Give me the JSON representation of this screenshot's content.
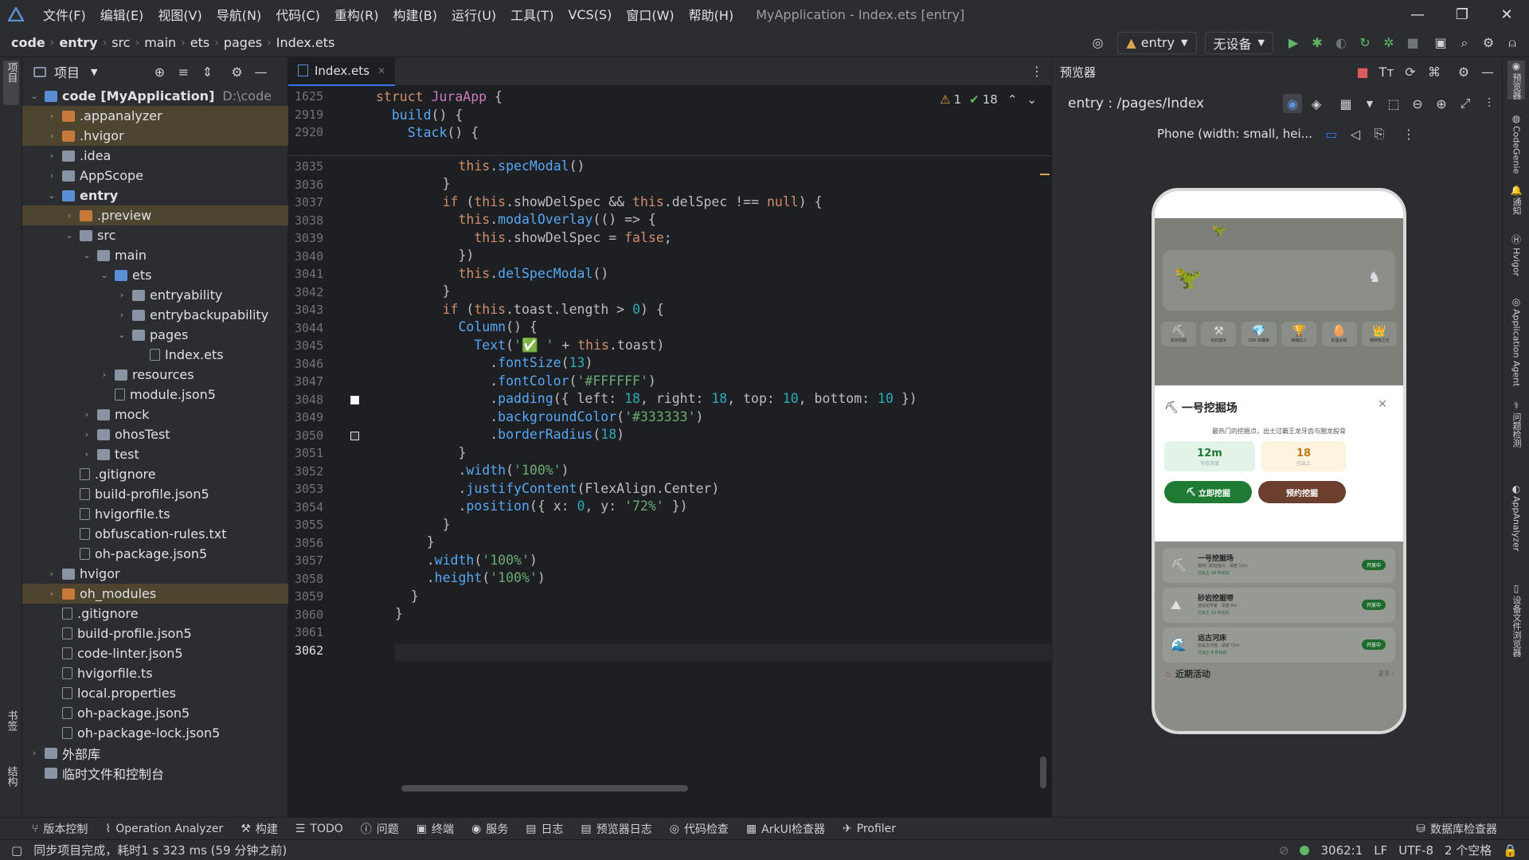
{
  "titlebar": {
    "menu": [
      "文件(F)",
      "编辑(E)",
      "视图(V)",
      "导航(N)",
      "代码(C)",
      "重构(R)",
      "构建(B)",
      "运行(U)",
      "工具(T)",
      "VCS(S)",
      "窗口(W)",
      "帮助(H)"
    ],
    "title": "MyApplication - Index.ets [entry]"
  },
  "breadcrumb": [
    "code",
    "entry",
    "src",
    "main",
    "ets",
    "pages",
    "Index.ets"
  ],
  "toolbar": {
    "module": "entry",
    "device": "无设备"
  },
  "left_strip": {
    "project": "项目",
    "bookmarks": "书签",
    "structure": "结构"
  },
  "project_panel": {
    "title": "项目",
    "tree": [
      {
        "depth": 0,
        "arrow": "down",
        "icon": "dirb",
        "label": "code [MyApplication]",
        "extra": "D:\\code",
        "bold": true
      },
      {
        "depth": 1,
        "arrow": "right",
        "icon": "dirx",
        "label": ".appanalyzer",
        "hl": true
      },
      {
        "depth": 1,
        "arrow": "right",
        "icon": "dirx",
        "label": ".hvigor",
        "hl": true
      },
      {
        "depth": 1,
        "arrow": "right",
        "icon": "dir",
        "label": ".idea"
      },
      {
        "depth": 1,
        "arrow": "right",
        "icon": "dir",
        "label": "AppScope"
      },
      {
        "depth": 1,
        "arrow": "down",
        "icon": "dirb",
        "label": "entry",
        "bold": true
      },
      {
        "depth": 2,
        "arrow": "right",
        "icon": "dirx",
        "label": ".preview",
        "hl": true
      },
      {
        "depth": 2,
        "arrow": "down",
        "icon": "dir",
        "label": "src"
      },
      {
        "depth": 3,
        "arrow": "down",
        "icon": "dir",
        "label": "main"
      },
      {
        "depth": 4,
        "arrow": "down",
        "icon": "dirb",
        "label": "ets"
      },
      {
        "depth": 5,
        "arrow": "right",
        "icon": "dir",
        "label": "entryability"
      },
      {
        "depth": 5,
        "arrow": "right",
        "icon": "dir",
        "label": "entrybackupability"
      },
      {
        "depth": 5,
        "arrow": "down",
        "icon": "dir",
        "label": "pages"
      },
      {
        "depth": 6,
        "arrow": "",
        "icon": "file",
        "label": "Index.ets"
      },
      {
        "depth": 4,
        "arrow": "right",
        "icon": "dir",
        "label": "resources"
      },
      {
        "depth": 4,
        "arrow": "",
        "icon": "file",
        "label": "module.json5"
      },
      {
        "depth": 3,
        "arrow": "right",
        "icon": "dir",
        "label": "mock"
      },
      {
        "depth": 3,
        "arrow": "right",
        "icon": "dir",
        "label": "ohosTest"
      },
      {
        "depth": 3,
        "arrow": "right",
        "icon": "dir",
        "label": "test"
      },
      {
        "depth": 2,
        "arrow": "",
        "icon": "file",
        "label": ".gitignore"
      },
      {
        "depth": 2,
        "arrow": "",
        "icon": "file",
        "label": "build-profile.json5"
      },
      {
        "depth": 2,
        "arrow": "",
        "icon": "file",
        "label": "hvigorfile.ts"
      },
      {
        "depth": 2,
        "arrow": "",
        "icon": "file",
        "label": "obfuscation-rules.txt"
      },
      {
        "depth": 2,
        "arrow": "",
        "icon": "file",
        "label": "oh-package.json5"
      },
      {
        "depth": 1,
        "arrow": "right",
        "icon": "dir",
        "label": "hvigor"
      },
      {
        "depth": 1,
        "arrow": "right",
        "icon": "dirx",
        "label": "oh_modules",
        "hl": true
      },
      {
        "depth": 1,
        "arrow": "",
        "icon": "file",
        "label": ".gitignore"
      },
      {
        "depth": 1,
        "arrow": "",
        "icon": "file",
        "label": "build-profile.json5"
      },
      {
        "depth": 1,
        "arrow": "",
        "icon": "file",
        "label": "code-linter.json5"
      },
      {
        "depth": 1,
        "arrow": "",
        "icon": "file",
        "label": "hvigorfile.ts"
      },
      {
        "depth": 1,
        "arrow": "",
        "icon": "file",
        "label": "local.properties"
      },
      {
        "depth": 1,
        "arrow": "",
        "icon": "file",
        "label": "oh-package.json5"
      },
      {
        "depth": 1,
        "arrow": "",
        "icon": "file",
        "label": "oh-package-lock.json5"
      },
      {
        "depth": 0,
        "arrow": "right",
        "icon": "dir",
        "label": "外部库"
      },
      {
        "depth": 0,
        "arrow": "",
        "icon": "dir",
        "label": "临时文件和控制台"
      }
    ]
  },
  "editor": {
    "tab": "Index.ets",
    "inspections": {
      "warnings": "1",
      "weak": "18"
    },
    "sticky": [
      {
        "n": "1625",
        "segs": [
          [
            "kw",
            "struct "
          ],
          [
            "ty",
            "JuraApp"
          ],
          [
            "pl",
            " {"
          ]
        ]
      },
      {
        "n": "2919",
        "segs": [
          [
            "pl",
            "  "
          ],
          [
            "fn",
            "build"
          ],
          [
            "pl",
            "() {"
          ]
        ]
      },
      {
        "n": "2920",
        "segs": [
          [
            "pl",
            "    "
          ],
          [
            "fn",
            "Stack"
          ],
          [
            "pl",
            "() {"
          ]
        ]
      }
    ],
    "lines": [
      {
        "n": "3035",
        "segs": [
          [
            "pl",
            "        })"
          ]
        ]
      },
      {
        "n": "3036",
        "segs": [
          [
            "pl",
            "        "
          ],
          [
            "th",
            "this"
          ],
          [
            "pl",
            "."
          ],
          [
            "ts",
            "specModal"
          ],
          [
            "pl",
            "()"
          ]
        ]
      },
      {
        "n": "3037",
        "segs": [
          [
            "pl",
            "      }"
          ]
        ]
      },
      {
        "n": "3038",
        "segs": [
          [
            "pl",
            "      "
          ],
          [
            "kw",
            "if"
          ],
          [
            "pl",
            " ("
          ],
          [
            "th",
            "this"
          ],
          [
            "pl",
            ".showDelSpec && "
          ],
          [
            "th",
            "this"
          ],
          [
            "pl",
            ".delSpec !== "
          ],
          [
            "kw",
            "null"
          ],
          [
            "pl",
            ") {"
          ]
        ]
      },
      {
        "n": "3039",
        "segs": [
          [
            "pl",
            "        "
          ],
          [
            "th",
            "this"
          ],
          [
            "pl",
            "."
          ],
          [
            "ts",
            "modalOverlay"
          ],
          [
            "pl",
            "(() => {"
          ]
        ]
      },
      {
        "n": "3040",
        "segs": [
          [
            "pl",
            "          "
          ],
          [
            "th",
            "this"
          ],
          [
            "pl",
            ".showDelSpec = "
          ],
          [
            "kw",
            "false"
          ],
          [
            "pl",
            ";"
          ]
        ]
      },
      {
        "n": "3041",
        "segs": [
          [
            "pl",
            "        })"
          ]
        ]
      },
      {
        "n": "3042",
        "segs": [
          [
            "pl",
            "        "
          ],
          [
            "th",
            "this"
          ],
          [
            "pl",
            "."
          ],
          [
            "ts",
            "delSpecModal"
          ],
          [
            "pl",
            "()"
          ]
        ]
      },
      {
        "n": "3043",
        "segs": [
          [
            "pl",
            "      }"
          ]
        ]
      },
      {
        "n": "3044",
        "segs": [
          [
            "pl",
            "      "
          ],
          [
            "kw",
            "if"
          ],
          [
            "pl",
            " ("
          ],
          [
            "th",
            "this"
          ],
          [
            "pl",
            ".toast.length > "
          ],
          [
            "nu",
            "0"
          ],
          [
            "pl",
            ") {"
          ]
        ]
      },
      {
        "n": "3045",
        "segs": [
          [
            "pl",
            "        "
          ],
          [
            "fn",
            "Column"
          ],
          [
            "pl",
            "() {"
          ]
        ]
      },
      {
        "n": "3046",
        "segs": [
          [
            "pl",
            "          "
          ],
          [
            "fn",
            "Text"
          ],
          [
            "pl",
            "("
          ],
          [
            "st",
            "'✅ '"
          ],
          [
            "pl",
            " + "
          ],
          [
            "th",
            "this"
          ],
          [
            "pl",
            ".toast)"
          ]
        ]
      },
      {
        "n": "3047",
        "segs": [
          [
            "pl",
            "            ."
          ],
          [
            "fn",
            "fontSize"
          ],
          [
            "pl",
            "("
          ],
          [
            "nu",
            "13"
          ],
          [
            "pl",
            ")"
          ]
        ]
      },
      {
        "n": "3048",
        "segs": [
          [
            "pl",
            "            ."
          ],
          [
            "fn",
            "fontColor"
          ],
          [
            "pl",
            "("
          ],
          [
            "st",
            "'#FFFFFF'"
          ],
          [
            "pl",
            ")"
          ]
        ]
      },
      {
        "n": "3049",
        "segs": [
          [
            "pl",
            "            ."
          ],
          [
            "fn",
            "padding"
          ],
          [
            "pl",
            "({ left: "
          ],
          [
            "nu",
            "18"
          ],
          [
            "pl",
            ", right: "
          ],
          [
            "nu",
            "18"
          ],
          [
            "pl",
            ", top: "
          ],
          [
            "nu",
            "10"
          ],
          [
            "pl",
            ", bottom: "
          ],
          [
            "nu",
            "10"
          ],
          [
            "pl",
            " })"
          ]
        ]
      },
      {
        "n": "3050",
        "segs": [
          [
            "pl",
            "            ."
          ],
          [
            "fn",
            "backgroundColor"
          ],
          [
            "pl",
            "("
          ],
          [
            "st",
            "'#333333'"
          ],
          [
            "pl",
            ")"
          ]
        ]
      },
      {
        "n": "3051",
        "segs": [
          [
            "pl",
            "            ."
          ],
          [
            "fn",
            "borderRadius"
          ],
          [
            "pl",
            "("
          ],
          [
            "nu",
            "18"
          ],
          [
            "pl",
            ")"
          ]
        ]
      },
      {
        "n": "3052",
        "segs": [
          [
            "pl",
            "        }"
          ]
        ]
      },
      {
        "n": "3053",
        "segs": [
          [
            "pl",
            "        ."
          ],
          [
            "fn",
            "width"
          ],
          [
            "pl",
            "("
          ],
          [
            "st",
            "'100%'"
          ],
          [
            "pl",
            ")"
          ]
        ]
      },
      {
        "n": "3054",
        "segs": [
          [
            "pl",
            "        ."
          ],
          [
            "fn",
            "justifyContent"
          ],
          [
            "pl",
            "(FlexAlign.Center)"
          ]
        ]
      },
      {
        "n": "3055",
        "segs": [
          [
            "pl",
            "        ."
          ],
          [
            "fn",
            "position"
          ],
          [
            "pl",
            "({ x: "
          ],
          [
            "nu",
            "0"
          ],
          [
            "pl",
            ", y: "
          ],
          [
            "st",
            "'72%'"
          ],
          [
            "pl",
            " })"
          ]
        ]
      },
      {
        "n": "3056",
        "segs": [
          [
            "pl",
            "      }"
          ]
        ]
      },
      {
        "n": "3057",
        "segs": [
          [
            "pl",
            "    }"
          ]
        ]
      },
      {
        "n": "3058",
        "segs": [
          [
            "pl",
            "    ."
          ],
          [
            "fn",
            "width"
          ],
          [
            "pl",
            "("
          ],
          [
            "st",
            "'100%'"
          ],
          [
            "pl",
            ")"
          ]
        ]
      },
      {
        "n": "3059",
        "segs": [
          [
            "pl",
            "    ."
          ],
          [
            "fn",
            "height"
          ],
          [
            "pl",
            "("
          ],
          [
            "st",
            "'100%'"
          ],
          [
            "pl",
            ")"
          ]
        ]
      },
      {
        "n": "3060",
        "segs": [
          [
            "pl",
            "  }"
          ]
        ]
      },
      {
        "n": "3061",
        "segs": [
          [
            "pl",
            "}"
          ]
        ]
      },
      {
        "n": "3062",
        "segs": [
          [
            "pl",
            ""
          ]
        ]
      }
    ]
  },
  "preview": {
    "title": "预览器",
    "route": "entry : /pages/Index",
    "device": "Phone (width: small, hei...",
    "phone": {
      "sheet_title": "一号挖掘场",
      "sheet_desc": "最热门的挖掘点，出土过霸王龙牙齿与腕龙股骨",
      "stat1": "12m",
      "stat1_label": "可挖深度",
      "stat2": "18",
      "stat2_label": "已出土",
      "btn_primary": "立即挖掘",
      "btn_secondary": "预约挖掘",
      "sites": [
        {
          "name": "一号挖掘场",
          "line1": "最热门的挖掘点 · 深度 12m",
          "line2": "已出土 18 件化石",
          "status": "开放中"
        },
        {
          "name": "砂岩挖掘带",
          "line1": "适合初学者 · 深度 8m",
          "line2": "已出土 12 件化石",
          "status": "开放中"
        },
        {
          "name": "远古河床",
          "line1": "曾是古河道 · 深度 15m",
          "line2": "已出土 9 件化石",
          "status": "开放中"
        }
      ],
      "recent": "近期活动",
      "more": "更多 ›",
      "categories": [
        "初次挖掘",
        "化石猎手",
        "SSR 收藏家",
        "骨骼达人",
        "彩蛋大师",
        "博物馆之光"
      ]
    }
  },
  "right_strip": [
    "预览器",
    "CodeGenie",
    "通知",
    "Hvigor",
    "Application Agent",
    "问题检测",
    "AppAnalyzer",
    "设备文件浏览器"
  ],
  "bottom_tools": [
    "版本控制",
    "Operation Analyzer",
    "构建",
    "TODO",
    "问题",
    "终端",
    "服务",
    "日志",
    "预览器日志",
    "代码检查",
    "ArkUI检查器",
    "Profiler"
  ],
  "bottom_right_tool": "数据库检查器",
  "status": {
    "message": "同步项目完成，耗时1 s 323 ms (59 分钟之前)",
    "position": "3062:1",
    "line_sep": "LF",
    "encoding": "UTF-8",
    "indent": "2 个空格"
  },
  "colors": {
    "accent": "#3574f0",
    "run_green": "#5fb865",
    "stop_red": "#db5c5c",
    "brown_btn": "#6b3e2e",
    "green_btn": "#1f7a33"
  }
}
